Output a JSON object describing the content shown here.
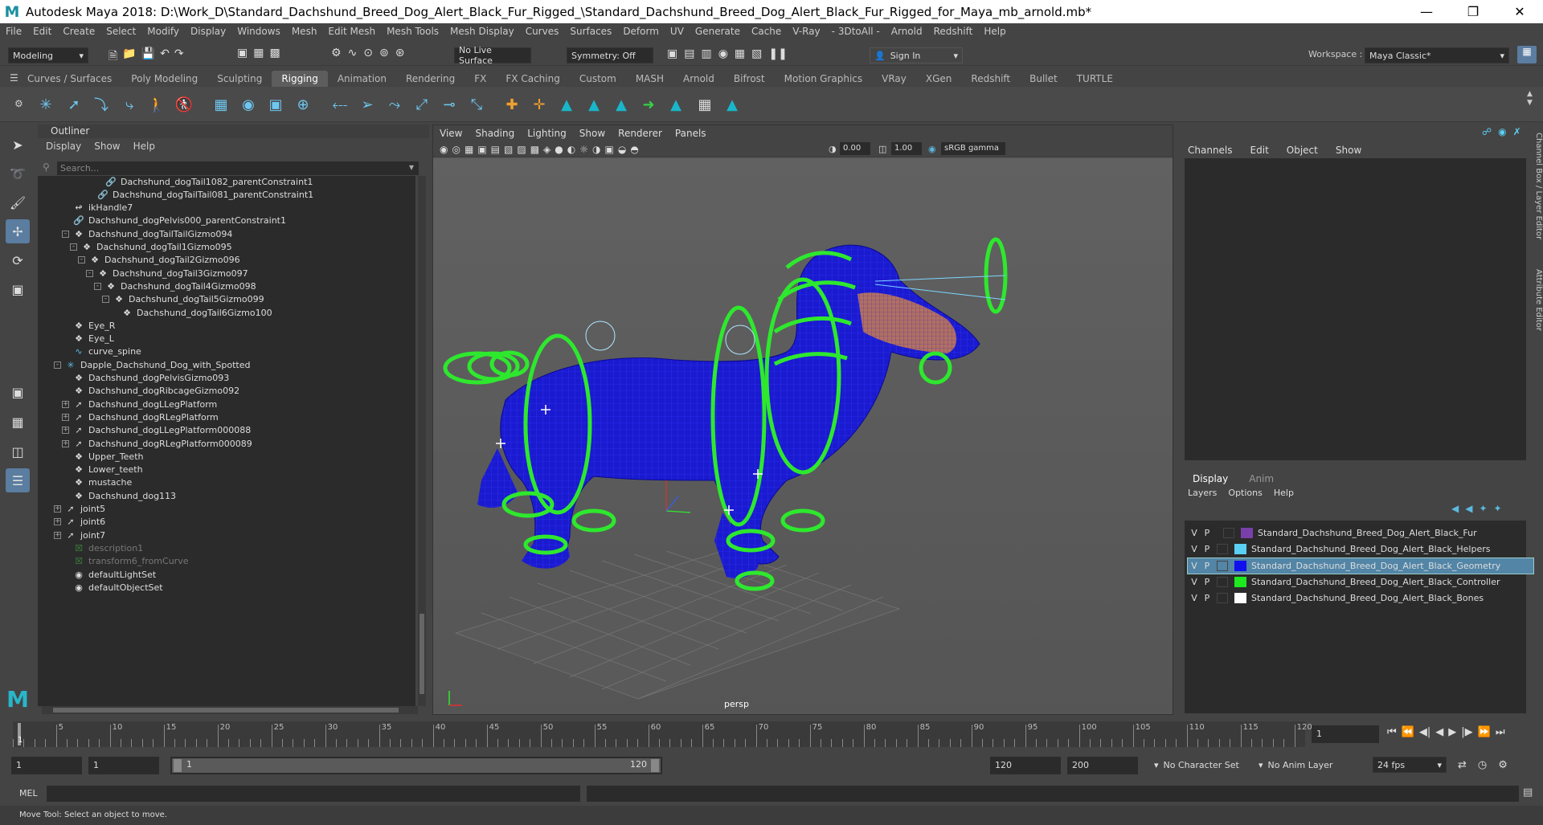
{
  "title": "Autodesk Maya 2018: D:\\Work_D\\Standard_Dachshund_Breed_Dog_Alert_Black_Fur_Rigged_\\Standard_Dachshund_Breed_Dog_Alert_Black_Fur_Rigged_for_Maya_mb_arnold.mb*",
  "menu": [
    "File",
    "Edit",
    "Create",
    "Select",
    "Modify",
    "Display",
    "Windows",
    "Mesh",
    "Edit Mesh",
    "Mesh Tools",
    "Mesh Display",
    "Curves",
    "Surfaces",
    "Deform",
    "UV",
    "Generate",
    "Cache",
    "V-Ray",
    "- 3DtoAll -",
    "Arnold",
    "Redshift",
    "Help"
  ],
  "status": {
    "mode": "Modeling",
    "live_surface": "No Live Surface",
    "symmetry": "Symmetry: Off",
    "sign_in": "Sign In",
    "workspace_label": "Workspace :",
    "workspace": "Maya Classic*"
  },
  "shelf_tabs": [
    "Curves / Surfaces",
    "Poly Modeling",
    "Sculpting",
    "Rigging",
    "Animation",
    "Rendering",
    "FX",
    "FX Caching",
    "Custom",
    "MASH",
    "Arnold",
    "Bifrost",
    "Motion Graphics",
    "VRay",
    "XGen",
    "Redshift",
    "Bullet",
    "TURTLE"
  ],
  "active_shelf_tab": "Rigging",
  "outliner": {
    "title": "Outliner",
    "menu": [
      "Display",
      "Show",
      "Help"
    ],
    "search_placeholder": "Search...",
    "items": [
      "Dachshund_dogTail1082_parentConstraint1",
      "Dachshund_dogTailTail081_parentConstraint1",
      "ikHandle7",
      "Dachshund_dogPelvis000_parentConstraint1",
      "Dachshund_dogTailTailGizmo094",
      "Dachshund_dogTail1Gizmo095",
      "Dachshund_dogTail2Gizmo096",
      "Dachshund_dogTail3Gizmo097",
      "Dachshund_dogTail4Gizmo098",
      "Dachshund_dogTail5Gizmo099",
      "Dachshund_dogTail6Gizmo100",
      "Eye_R",
      "Eye_L",
      "curve_spine",
      "Dapple_Dachshund_Dog_with_Spotted",
      "Dachshund_dogPelvisGizmo093",
      "Dachshund_dogRibcageGizmo092",
      "Dachshund_dogLLegPlatform",
      "Dachshund_dogRLegPlatform",
      "Dachshund_dogLLegPlatform000088",
      "Dachshund_dogRLegPlatform000089",
      "Upper_Teeth",
      "Lower_teeth",
      "mustache",
      "Dachshund_dog113",
      "joint5",
      "joint6",
      "joint7",
      "description1",
      "transform6_fromCurve",
      "defaultLightSet",
      "defaultObjectSet"
    ]
  },
  "viewport": {
    "menu": [
      "View",
      "Shading",
      "Lighting",
      "Show",
      "Renderer",
      "Panels"
    ],
    "field1": "0.00",
    "field2": "1.00",
    "color_space": "sRGB gamma",
    "camera": "persp"
  },
  "channel_box": {
    "menu": [
      "Channels",
      "Edit",
      "Object",
      "Show"
    ],
    "side_tab1": "Channel Box / Layer Editor",
    "side_tab2": "Attribute Editor"
  },
  "layers": {
    "tabs": [
      "Display",
      "Anim"
    ],
    "menu": [
      "Layers",
      "Options",
      "Help"
    ],
    "v": "V",
    "p": "P",
    "rows": [
      {
        "name": "Standard_Dachshund_Breed_Dog_Alert_Black_Fur",
        "color": "#7a3fa8"
      },
      {
        "name": "Standard_Dachshund_Breed_Dog_Alert_Black_Helpers",
        "color": "#5bd0f5"
      },
      {
        "name": "Standard_Dachshund_Breed_Dog_Alert_Black_Geometry",
        "color": "#1010ee"
      },
      {
        "name": "Standard_Dachshund_Breed_Dog_Alert_Black_Controller",
        "color": "#1ee81e"
      },
      {
        "name": "Standard_Dachshund_Breed_Dog_Alert_Black_Bones",
        "color": "#ffffff"
      }
    ],
    "selected_index": 2
  },
  "timeline": {
    "ticks": [
      "5",
      "10",
      "15",
      "20",
      "25",
      "30",
      "35",
      "40",
      "45",
      "50",
      "55",
      "60",
      "65",
      "70",
      "75",
      "80",
      "85",
      "90",
      "95",
      "100",
      "105",
      "110",
      "115",
      "120"
    ],
    "current_frame": "1",
    "frame_marker": "1"
  },
  "range": {
    "start": "1",
    "playback_start": "1",
    "slider_start": "1",
    "slider_end": "120",
    "playback_end": "120",
    "end": "200",
    "character_set": "No Character Set",
    "anim_layer": "No Anim Layer",
    "fps": "24 fps"
  },
  "command": {
    "label": "MEL"
  },
  "help_text": "Move Tool: Select an object to move."
}
